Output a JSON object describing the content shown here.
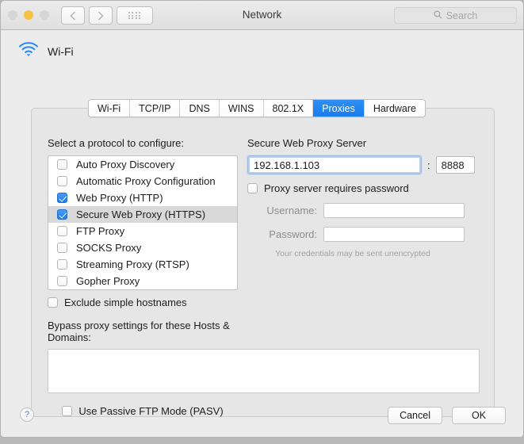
{
  "window": {
    "title": "Network",
    "traffic_lights": [
      "close",
      "minimize",
      "zoom"
    ],
    "back_icon": "chevron-left-icon",
    "forward_icon": "chevron-right-icon",
    "grid_icon": "show-all-grid-icon"
  },
  "search": {
    "placeholder": "Search",
    "icon": "search-icon"
  },
  "service": {
    "icon": "wifi-icon",
    "name": "Wi-Fi"
  },
  "tabs": [
    {
      "label": "Wi-Fi",
      "active": false
    },
    {
      "label": "TCP/IP",
      "active": false
    },
    {
      "label": "DNS",
      "active": false
    },
    {
      "label": "WINS",
      "active": false
    },
    {
      "label": "802.1X",
      "active": false
    },
    {
      "label": "Proxies",
      "active": true
    },
    {
      "label": "Hardware",
      "active": false
    }
  ],
  "protocols": {
    "heading": "Select a protocol to configure:",
    "items": [
      {
        "label": "Auto Proxy Discovery",
        "checked": false,
        "selected": false
      },
      {
        "label": "Automatic Proxy Configuration",
        "checked": false,
        "selected": false
      },
      {
        "label": "Web Proxy (HTTP)",
        "checked": true,
        "selected": false
      },
      {
        "label": "Secure Web Proxy (HTTPS)",
        "checked": true,
        "selected": true
      },
      {
        "label": "FTP Proxy",
        "checked": false,
        "selected": false
      },
      {
        "label": "SOCKS Proxy",
        "checked": false,
        "selected": false
      },
      {
        "label": "Streaming Proxy (RTSP)",
        "checked": false,
        "selected": false
      },
      {
        "label": "Gopher Proxy",
        "checked": false,
        "selected": false
      }
    ]
  },
  "exclude": {
    "label": "Exclude simple hostnames",
    "checked": false
  },
  "bypass": {
    "label": "Bypass proxy settings for these Hosts & Domains:",
    "value": ""
  },
  "pasv": {
    "label": "Use Passive FTP Mode (PASV)",
    "checked": false
  },
  "proxy_config": {
    "heading": "Secure Web Proxy Server",
    "server": "192.168.1.103",
    "server_placeholder": "",
    "separator": ":",
    "port": "8888",
    "port_placeholder": "",
    "requires_password": {
      "label": "Proxy server requires password",
      "checked": false
    },
    "username_label": "Username:",
    "username": "",
    "password_label": "Password:",
    "password": "",
    "note": "Your credentials may be sent unencrypted"
  },
  "footer": {
    "help_label": "?",
    "cancel_label": "Cancel",
    "ok_label": "OK"
  },
  "colors": {
    "accent": "#1e7ced",
    "tab_active": "#1a7ced",
    "window_bg": "#ececec",
    "panel_bg": "#e6e6e6",
    "selected_row": "#d9d9d9",
    "wifi_icon": "#2f8bf0"
  }
}
